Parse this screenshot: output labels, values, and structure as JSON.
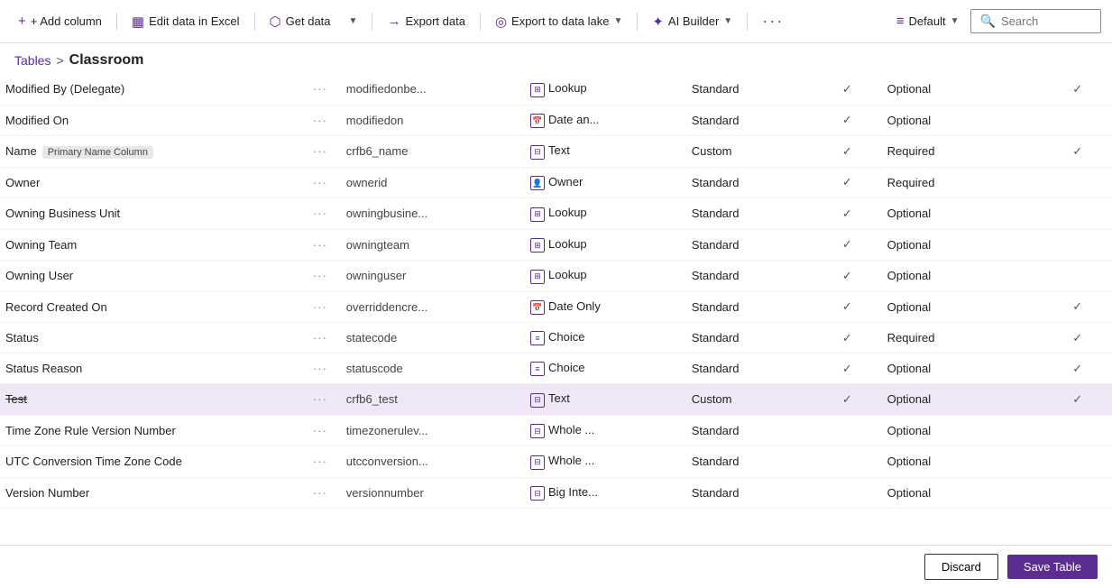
{
  "toolbar": {
    "add_column": "+ Add column",
    "edit_excel": "Edit data in Excel",
    "get_data": "Get data",
    "export_data": "Export data",
    "export_lake": "Export to data lake",
    "ai_builder": "AI Builder",
    "more": "···",
    "default": "Default",
    "search": "Search"
  },
  "breadcrumb": {
    "tables": "Tables",
    "separator": ">",
    "current": "Classroom"
  },
  "columns": [
    {
      "name": "Modified By (Delegate)",
      "tag": "",
      "logical": "modifiedonbe...",
      "type_icon": "lookup",
      "type": "Lookup",
      "custom": "Standard",
      "check1": "✓",
      "required": "Optional",
      "check2": "✓",
      "selected": false,
      "strikethrough": false
    },
    {
      "name": "Modified On",
      "tag": "",
      "logical": "modifiedon",
      "type_icon": "date",
      "type": "Date an...",
      "custom": "Standard",
      "check1": "✓",
      "required": "Optional",
      "check2": "",
      "selected": false,
      "strikethrough": false
    },
    {
      "name": "Name",
      "tag": "Primary Name Column",
      "logical": "crfb6_name",
      "type_icon": "text",
      "type": "Text",
      "custom": "Custom",
      "check1": "✓",
      "required": "Required",
      "check2": "✓",
      "selected": false,
      "strikethrough": false
    },
    {
      "name": "Owner",
      "tag": "",
      "logical": "ownerid",
      "type_icon": "owner",
      "type": "Owner",
      "custom": "Standard",
      "check1": "✓",
      "required": "Required",
      "check2": "",
      "selected": false,
      "strikethrough": false
    },
    {
      "name": "Owning Business Unit",
      "tag": "",
      "logical": "owningbusine...",
      "type_icon": "lookup",
      "type": "Lookup",
      "custom": "Standard",
      "check1": "✓",
      "required": "Optional",
      "check2": "",
      "selected": false,
      "strikethrough": false
    },
    {
      "name": "Owning Team",
      "tag": "",
      "logical": "owningteam",
      "type_icon": "lookup",
      "type": "Lookup",
      "custom": "Standard",
      "check1": "✓",
      "required": "Optional",
      "check2": "",
      "selected": false,
      "strikethrough": false
    },
    {
      "name": "Owning User",
      "tag": "",
      "logical": "owninguser",
      "type_icon": "lookup",
      "type": "Lookup",
      "custom": "Standard",
      "check1": "✓",
      "required": "Optional",
      "check2": "",
      "selected": false,
      "strikethrough": false
    },
    {
      "name": "Record Created On",
      "tag": "",
      "logical": "overriddencre...",
      "type_icon": "date",
      "type": "Date Only",
      "custom": "Standard",
      "check1": "✓",
      "required": "Optional",
      "check2": "✓",
      "selected": false,
      "strikethrough": false
    },
    {
      "name": "Status",
      "tag": "",
      "logical": "statecode",
      "type_icon": "choice",
      "type": "Choice",
      "custom": "Standard",
      "check1": "✓",
      "required": "Required",
      "check2": "✓",
      "selected": false,
      "strikethrough": false
    },
    {
      "name": "Status Reason",
      "tag": "",
      "logical": "statuscode",
      "type_icon": "choice",
      "type": "Choice",
      "custom": "Standard",
      "check1": "✓",
      "required": "Optional",
      "check2": "✓",
      "selected": false,
      "strikethrough": false
    },
    {
      "name": "Test",
      "tag": "",
      "logical": "crfb6_test",
      "type_icon": "text",
      "type": "Text",
      "custom": "Custom",
      "check1": "✓",
      "required": "Optional",
      "check2": "✓",
      "selected": true,
      "strikethrough": true
    },
    {
      "name": "Time Zone Rule Version Number",
      "tag": "",
      "logical": "timezonerulev...",
      "type_icon": "whole",
      "type": "Whole ...",
      "custom": "Standard",
      "check1": "",
      "required": "Optional",
      "check2": "",
      "selected": false,
      "strikethrough": false
    },
    {
      "name": "UTC Conversion Time Zone Code",
      "tag": "",
      "logical": "utcconversion...",
      "type_icon": "whole",
      "type": "Whole ...",
      "custom": "Standard",
      "check1": "",
      "required": "Optional",
      "check2": "",
      "selected": false,
      "strikethrough": false
    },
    {
      "name": "Version Number",
      "tag": "",
      "logical": "versionnumber",
      "type_icon": "bigint",
      "type": "Big Inte...",
      "custom": "Standard",
      "check1": "",
      "required": "Optional",
      "check2": "",
      "selected": false,
      "strikethrough": false
    }
  ],
  "footer": {
    "discard": "Discard",
    "save": "Save Table"
  },
  "icons": {
    "lookup": "⊞",
    "date": "📅",
    "text": "⊟",
    "owner": "👤",
    "choice": "≡",
    "whole": "⊟",
    "bigint": "⊟",
    "dots": "···"
  }
}
